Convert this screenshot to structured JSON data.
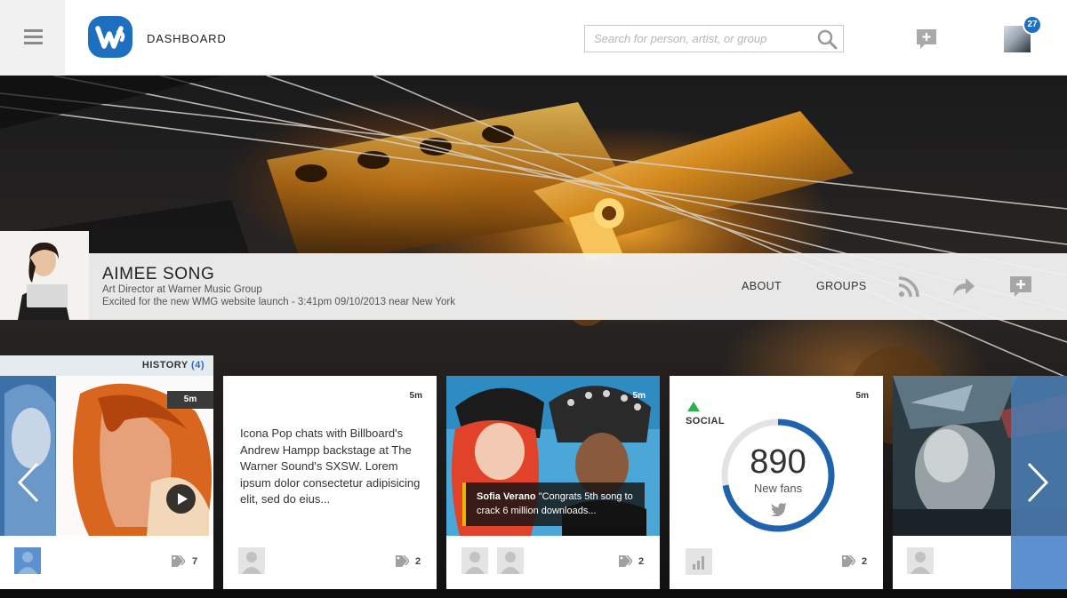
{
  "header": {
    "title": "DASHBOARD",
    "search_placeholder": "Search for person, artist, or group",
    "notification_count": "27",
    "accent_color": "#1f6fc0"
  },
  "profile": {
    "name": "AIMEE SONG",
    "role": "Art Director at Warner Music Group",
    "status": "Excited for the new WMG website launch - 3:41pm 09/10/2013 near New York",
    "links": [
      "ABOUT",
      "GROUPS"
    ],
    "actions": [
      "rss-icon",
      "share-icon",
      "compose-icon"
    ]
  },
  "history": {
    "label": "HISTORY",
    "count": "(4)"
  },
  "cards": [
    {
      "type": "video",
      "time": "5m",
      "tag_count": "7"
    },
    {
      "type": "text",
      "time": "5m",
      "text": "Icona Pop chats with Billboard's Andrew Hampp backstage at The Warner Sound's SXSW. Lorem ipsum dolor consectetur adipisicing elit, sed do eius...",
      "tag_count": "2"
    },
    {
      "type": "quote",
      "time": "5m",
      "quote_author": "Sofia Verano",
      "quote_text": " \"Congrats 5th song to crack 6 million downloads...",
      "tag_count": "2"
    },
    {
      "type": "social",
      "time": "5m",
      "label": "SOCIAL",
      "value": "890",
      "value_label": "New fans",
      "progress": 0.72,
      "tag_count": "2",
      "trend_color": "#2bb24c"
    },
    {
      "type": "image"
    }
  ]
}
